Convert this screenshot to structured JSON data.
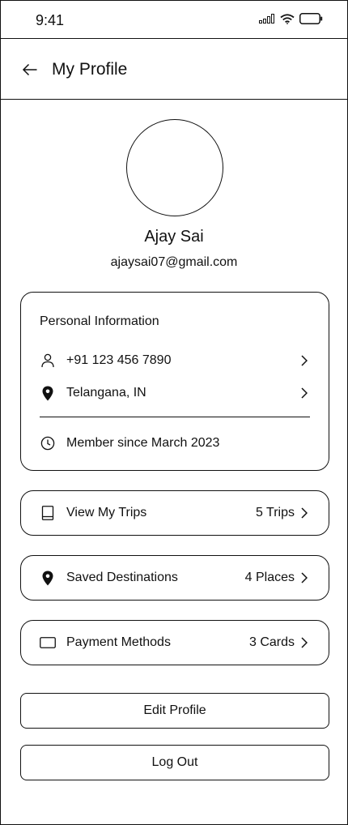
{
  "status_bar": {
    "time": "9:41"
  },
  "header": {
    "title": "My Profile"
  },
  "profile": {
    "name": "Ajay Sai",
    "email": "ajaysai07@gmail.com"
  },
  "personal_info": {
    "title": "Personal Information",
    "phone": "+91 123 456 7890",
    "location": "Telangana, IN",
    "member_since": "Member since March 2023"
  },
  "actions": [
    {
      "label": "View My Trips",
      "value": "5 Trips",
      "icon": "book-icon"
    },
    {
      "label": "Saved Destinations",
      "value": "4 Places",
      "icon": "location-pin-icon"
    },
    {
      "label": "Payment Methods",
      "value": "3 Cards",
      "icon": "card-icon"
    }
  ],
  "buttons": {
    "edit_profile": "Edit Profile",
    "log_out": "Log Out"
  }
}
